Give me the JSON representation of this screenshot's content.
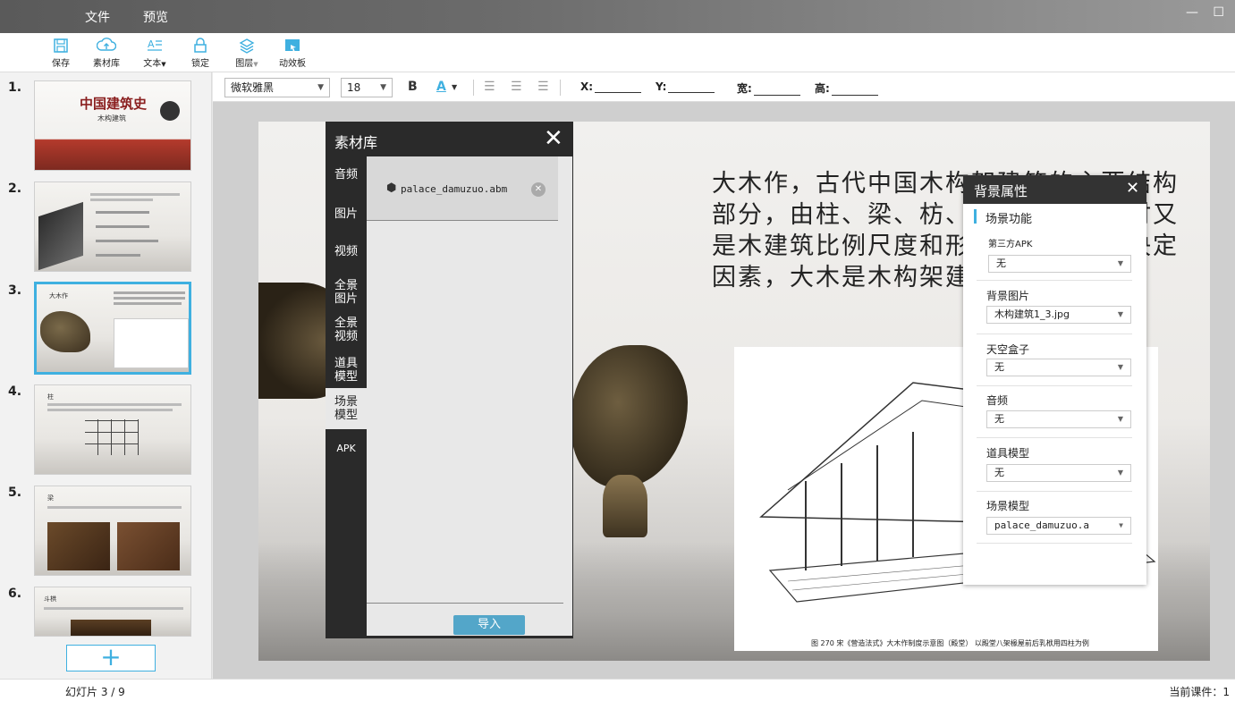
{
  "menu": {
    "file": "文件",
    "preview": "预览",
    "window_controls": "— ☐"
  },
  "toolbar": {
    "save": "保存",
    "assets": "素材库",
    "text": "文本",
    "lock": "锁定",
    "layers": "图层",
    "animation": "动效板"
  },
  "slides": [
    {
      "num": "1.",
      "title": "中国建筑史",
      "subtitle": "木构建筑"
    },
    {
      "num": "2."
    },
    {
      "num": "3.",
      "title": "大木作"
    },
    {
      "num": "4.",
      "title": "柱"
    },
    {
      "num": "5.",
      "title": "梁"
    },
    {
      "num": "6.",
      "title": "斗栱"
    }
  ],
  "add_slide": "+",
  "format": {
    "font": "微软雅黑",
    "size": "18",
    "bold": "B",
    "color": "A",
    "x_label": "X:",
    "y_label": "Y:",
    "w_label": "宽:",
    "h_label": "高:"
  },
  "slide_text": "大木作，古代中国木构架建筑的主要结构部分，由柱、梁、枋、檩等组成。同时又是木建筑比例尺度和形体外观的重要决定因素，大木是木构架建筑的承重部分。",
  "drawing_caption": "图 270  宋《营造法式》大木作制度示意图（殿堂）  以殿堂八架椽屋前后乳栿用四柱为例",
  "asset_dialog": {
    "title": "素材库",
    "close": "✕",
    "tabs": [
      "音频",
      "图片",
      "视频",
      "全景图片",
      "全景视频",
      "道具模型",
      "场景模型",
      "APK"
    ],
    "active_tab": "场景模型",
    "file": "palace_damuzuo.abm",
    "import": "导入"
  },
  "bg_props": {
    "title": "背景属性",
    "close": "✕",
    "section": "场景功能",
    "apk_label": "第三方APK",
    "apk_value": "无",
    "bgimg_label": "背景图片",
    "bgimg_value": "木构建筑1_3.jpg",
    "skybox_label": "天空盒子",
    "skybox_value": "无",
    "audio_label": "音频",
    "audio_value": "无",
    "prop_label": "道具模型",
    "prop_value": "无",
    "scene_label": "场景模型",
    "scene_value": "palace_damuzuo.a"
  },
  "status": {
    "slide_counter": "幻灯片 3 / 9",
    "current": "当前课件：1"
  },
  "colors": {
    "accent": "#3fb0e0",
    "dialog_dark": "#2a2a2a",
    "import_button": "#53a6c9"
  }
}
